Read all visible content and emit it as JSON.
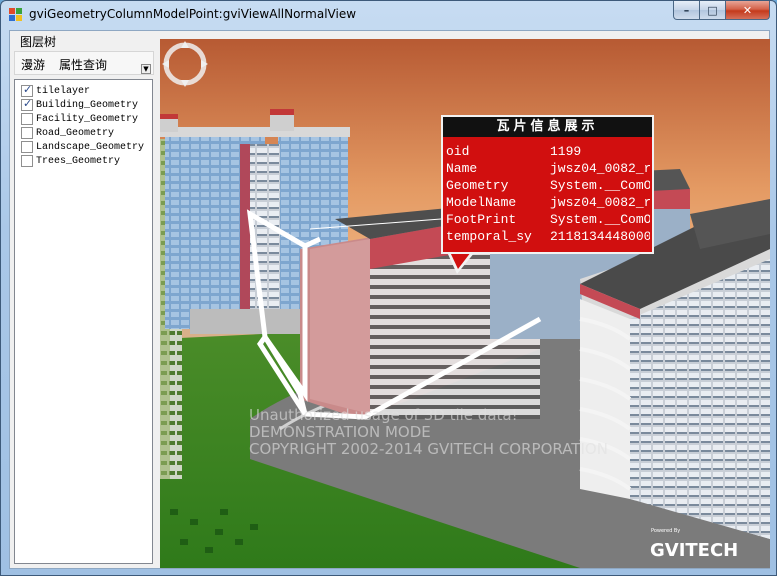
{
  "window": {
    "title": "gviGeometryColumnModelPoint:gviViewAllNormalView",
    "buttons": {
      "minimize": "–",
      "maximize": "□",
      "close": "✕"
    }
  },
  "left_panel": {
    "header": "图层树",
    "tabs": [
      {
        "label": "漫游"
      },
      {
        "label": "属性查询"
      }
    ],
    "tab_overflow_icon": "chevron-down-icon",
    "layers": [
      {
        "label": "tilelayer",
        "checked": true
      },
      {
        "label": "Building_Geometry",
        "checked": true
      },
      {
        "label": "Facility_Geometry",
        "checked": false
      },
      {
        "label": "Road_Geometry",
        "checked": false
      },
      {
        "label": "Landscape_Geometry",
        "checked": false
      },
      {
        "label": "Trees_Geometry",
        "checked": false
      }
    ]
  },
  "viewport": {
    "compass_icon": "compass-icon",
    "popup": {
      "title": "瓦片信息展示",
      "rows": [
        {
          "key": "oid",
          "value": "1199"
        },
        {
          "key": "Name",
          "value": "jwsz04_0082_r"
        },
        {
          "key": "Geometry",
          "value": "System.__ComO"
        },
        {
          "key": "ModelName",
          "value": "jwsz04_0082_r"
        },
        {
          "key": "FootPrint",
          "value": "System.__ComO"
        },
        {
          "key": "temporal_sy",
          "value": "2118134448000"
        }
      ]
    },
    "watermark": [
      "Unauthorized usage of 3D tile data!",
      "DEMONSTRATION MODE",
      "COPYRIGHT 2002-2014 GVITECH CORPORATION"
    ],
    "logo_caption": "Powered By",
    "logo": "GVITECH"
  },
  "colors": {
    "popup_bg": "#d10f0f",
    "popup_title_bg": "#111111",
    "sky_top": "#c96b3c",
    "grass": "#3e8a22"
  }
}
